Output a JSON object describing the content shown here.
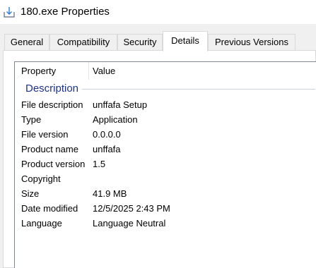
{
  "window": {
    "title": "180.exe Properties",
    "icon": "file-download-icon"
  },
  "tabs": [
    {
      "label": "General"
    },
    {
      "label": "Compatibility"
    },
    {
      "label": "Security"
    },
    {
      "label": "Details",
      "active": true
    },
    {
      "label": "Previous Versions"
    }
  ],
  "details": {
    "columns": {
      "property": "Property",
      "value": "Value"
    },
    "group": "Description",
    "rows": [
      {
        "property": "File description",
        "value": "unffafa Setup"
      },
      {
        "property": "Type",
        "value": "Application"
      },
      {
        "property": "File version",
        "value": "0.0.0.0"
      },
      {
        "property": "Product name",
        "value": "unffafa"
      },
      {
        "property": "Product version",
        "value": "1.5"
      },
      {
        "property": "Copyright",
        "value": ""
      },
      {
        "property": "Size",
        "value": "41.9 MB"
      },
      {
        "property": "Date modified",
        "value": "12/5/2025 2:43 PM"
      },
      {
        "property": "Language",
        "value": "Language Neutral"
      }
    ]
  },
  "colors": {
    "group_heading": "#1e3287",
    "tab_border": "#d9d9d9"
  }
}
